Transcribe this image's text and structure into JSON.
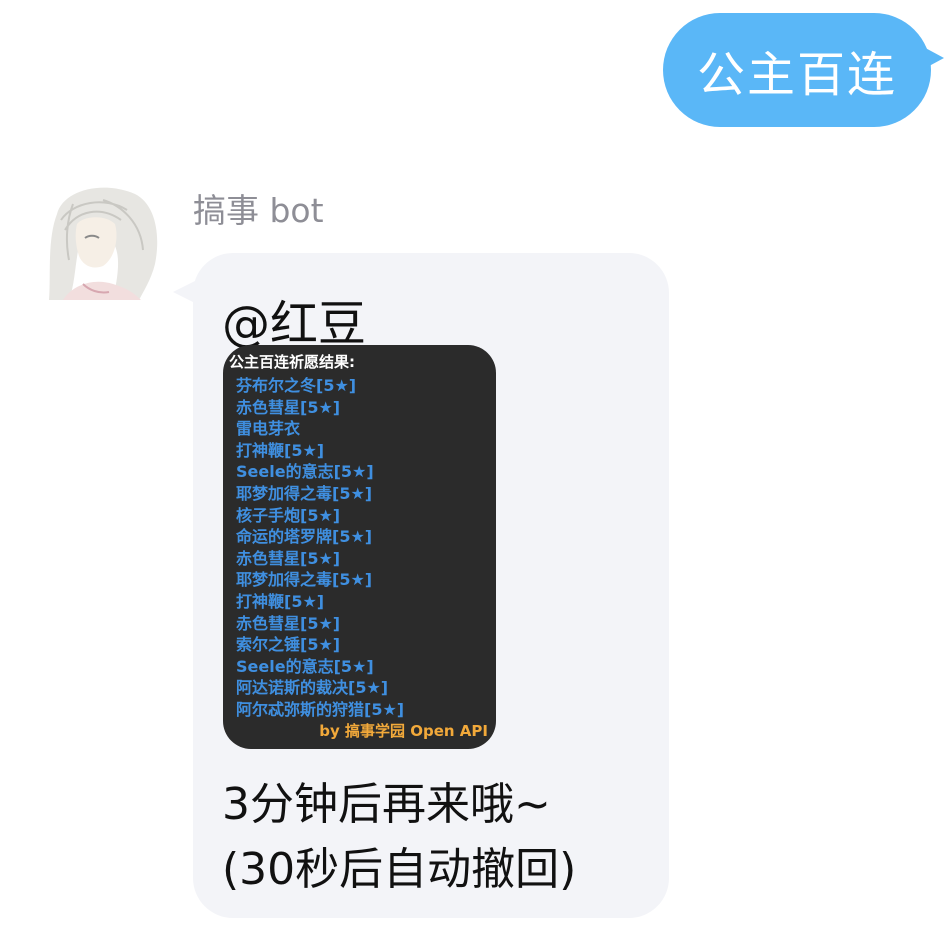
{
  "outgoing": {
    "text": "公主百连",
    "bubble_color": "#5ab7f7"
  },
  "incoming": {
    "sender_name": "搞事 bot",
    "avatar_icon": "avatar-anime-girl-icon",
    "bubble_color": "#f3f4f8",
    "mention": "@红豆",
    "result_card": {
      "title": "公主百连祈愿结果:",
      "items": [
        "芬布尔之冬[5★]",
        "赤色彗星[5★]",
        "雷电芽衣",
        "打神鞭[5★]",
        "Seele的意志[5★]",
        "耶梦加得之毒[5★]",
        "核子手炮[5★]",
        "命运的塔罗牌[5★]",
        "赤色彗星[5★]",
        "耶梦加得之毒[5★]",
        "打神鞭[5★]",
        "赤色彗星[5★]",
        "索尔之锤[5★]",
        "Seele的意志[5★]",
        "阿达诺斯的裁决[5★]",
        "阿尔忒弥斯的狩猎[5★]"
      ],
      "footer": "by 搞事学园 Open API",
      "item_color": "#3f8fe0",
      "footer_color": "#f2a93a"
    },
    "reply_line_1": "3分钟后再来哦~",
    "reply_line_2": "(30秒后自动撤回)"
  }
}
